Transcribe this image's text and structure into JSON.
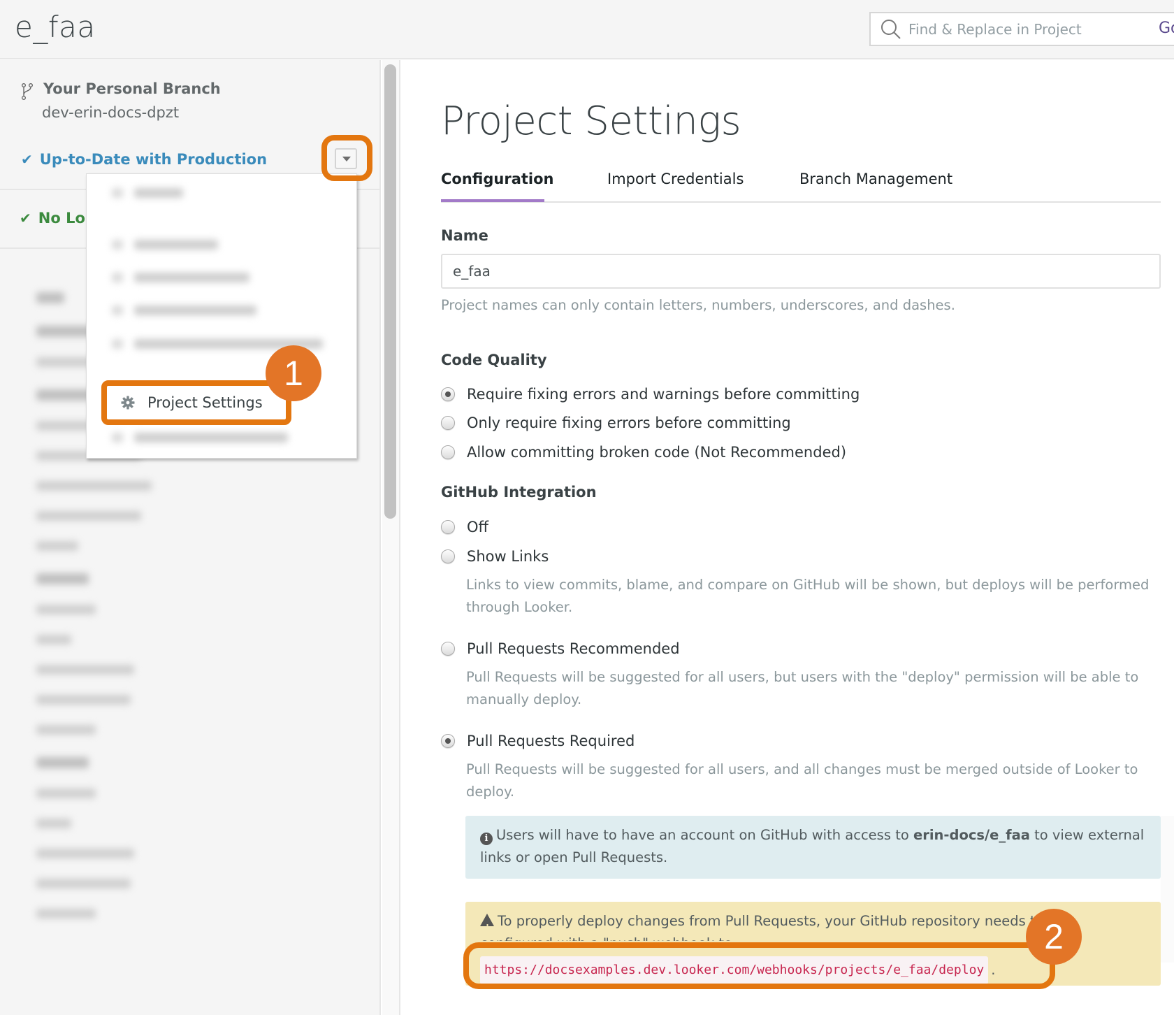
{
  "header": {
    "title": "e_faa",
    "search": {
      "placeholder": "Find & Replace in Project",
      "value": "",
      "icon": "search-icon"
    },
    "go_label": "Go"
  },
  "sidebar": {
    "branch": {
      "icon": "git-branch-icon",
      "title": "Your Personal Branch",
      "name": "dev-erin-docs-dpzt"
    },
    "status": {
      "label": "Up-to-Date with Production",
      "icon": "check-icon",
      "color": "#3a8bbb"
    },
    "local_status": {
      "label": "No Lo",
      "icon": "check-icon",
      "color": "#3b8a3e"
    },
    "git_menu_button": {
      "icon": "caret-down-icon"
    }
  },
  "dropdown": {
    "items": [
      {
        "label": "Project Settings",
        "icon": "gear-icon",
        "highlighted": true
      }
    ]
  },
  "annotations": [
    {
      "number": "1",
      "target": "Project Settings menu item"
    },
    {
      "number": "2",
      "target": "webhook URL"
    }
  ],
  "main": {
    "page_title": "Project Settings",
    "tabs": [
      {
        "label": "Configuration",
        "active": true
      },
      {
        "label": "Import Credentials",
        "active": false
      },
      {
        "label": "Branch Management",
        "active": false
      }
    ],
    "name_section": {
      "label": "Name",
      "value": "e_faa",
      "help": "Project names can only contain letters, numbers, underscores, and dashes."
    },
    "code_quality": {
      "label": "Code Quality",
      "options": [
        {
          "label": "Require fixing errors and warnings before committing",
          "checked": true
        },
        {
          "label": "Only require fixing errors before committing",
          "checked": false
        },
        {
          "label": "Allow committing broken code (Not Recommended)",
          "checked": false
        }
      ]
    },
    "github_integration": {
      "label": "GitHub Integration",
      "options": [
        {
          "label": "Off",
          "checked": false,
          "description": ""
        },
        {
          "label": "Show Links",
          "checked": false,
          "description": "Links to view commits, blame, and compare on GitHub will be shown, but deploys will be performed through Looker."
        },
        {
          "label": "Pull Requests Recommended",
          "checked": false,
          "description": "Pull Requests will be suggested for all users, but users with the \"deploy\" permission will be able to manually deploy."
        },
        {
          "label": "Pull Requests Required",
          "checked": true,
          "description": "Pull Requests will be suggested for all users, and all changes must be merged outside of Looker to deploy."
        }
      ]
    },
    "info_box": {
      "icon": "info-icon",
      "text_before": "Users will have to have an account on GitHub with access to",
      "repo": "erin-docs/e_faa",
      "text_after": "to view external links or open Pull Requests."
    },
    "warning_box": {
      "icon": "warning-icon",
      "line1": "To properly deploy changes from Pull Requests, your GitHub repository needs to be",
      "line2": "configured with a \"push\" webhook to",
      "url": "https://docsexamples.dev.looker.com/webhooks/projects/e_faa/deploy",
      "trailing": "."
    }
  }
}
